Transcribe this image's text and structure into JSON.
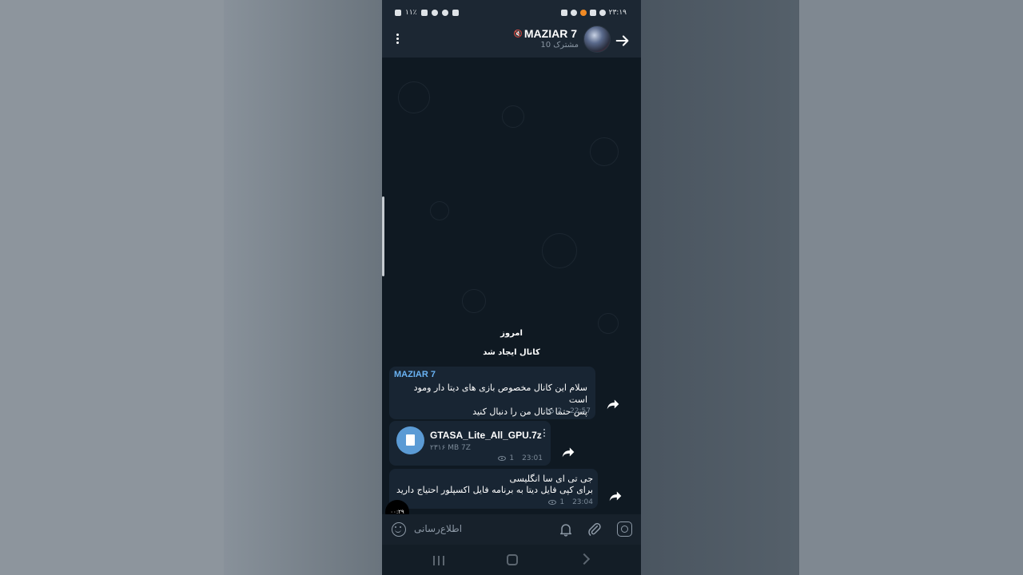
{
  "status_bar": {
    "time": "۲۳:۱۹",
    "battery": "۱۱٪"
  },
  "header": {
    "channel_name": "MAZIAR 7",
    "subscribers": "10 مشترک",
    "back_icon": "arrow-right-icon",
    "menu_icon": "more-vertical-icon"
  },
  "chat": {
    "date_label": "امروز",
    "service_message": "کانال ایجاد شد",
    "messages": [
      {
        "sender": "MAZIAR 7",
        "lines": [
          "سلام این کانال مخصوص بازی های دیتا دار ومود است",
          "پس حتما کانال من را دنبال کنید"
        ],
        "views": "2",
        "time": "22:57"
      },
      {
        "file_name": "GTASA_Lite_All_GPU.7z",
        "file_size": "۲۳۱۶ MB 7Z",
        "views": "1",
        "time": "23:01"
      },
      {
        "lines": [
          "جی تی ای سا انگلیسی",
          "برای کپی فایل دیتا به برنامه فایل اکسپلور احتیاج دارید"
        ],
        "views": "1",
        "time": "23:04"
      }
    ],
    "timer_badge": "۰۰:۲۹"
  },
  "composer": {
    "placeholder": "اطلاع‌رسانی",
    "icons": [
      "emoji-icon",
      "bell-icon",
      "paperclip-icon",
      "instagram-icon"
    ]
  },
  "colors": {
    "header_bg": "#1c2733",
    "chat_bg": "#0f1922",
    "bubble_bg": "#182533",
    "accent": "#6ab3f3"
  }
}
